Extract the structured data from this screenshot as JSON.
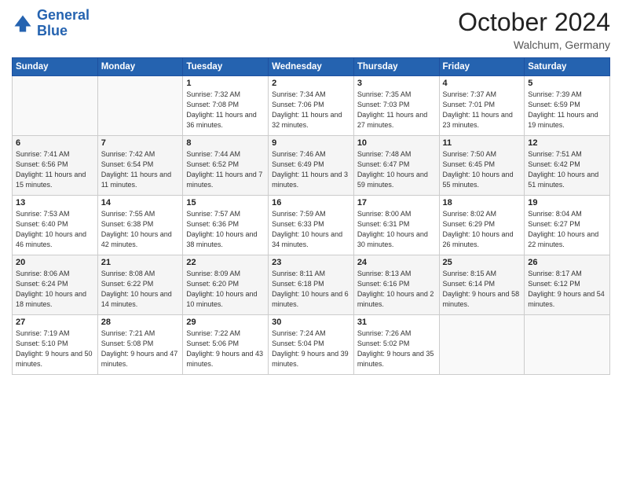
{
  "logo": {
    "line1": "General",
    "line2": "Blue"
  },
  "title": "October 2024",
  "location": "Walchum, Germany",
  "days_of_week": [
    "Sunday",
    "Monday",
    "Tuesday",
    "Wednesday",
    "Thursday",
    "Friday",
    "Saturday"
  ],
  "weeks": [
    [
      {
        "day": "",
        "content": ""
      },
      {
        "day": "",
        "content": ""
      },
      {
        "day": "1",
        "content": "Sunrise: 7:32 AM\nSunset: 7:08 PM\nDaylight: 11 hours and 36 minutes."
      },
      {
        "day": "2",
        "content": "Sunrise: 7:34 AM\nSunset: 7:06 PM\nDaylight: 11 hours and 32 minutes."
      },
      {
        "day": "3",
        "content": "Sunrise: 7:35 AM\nSunset: 7:03 PM\nDaylight: 11 hours and 27 minutes."
      },
      {
        "day": "4",
        "content": "Sunrise: 7:37 AM\nSunset: 7:01 PM\nDaylight: 11 hours and 23 minutes."
      },
      {
        "day": "5",
        "content": "Sunrise: 7:39 AM\nSunset: 6:59 PM\nDaylight: 11 hours and 19 minutes."
      }
    ],
    [
      {
        "day": "6",
        "content": "Sunrise: 7:41 AM\nSunset: 6:56 PM\nDaylight: 11 hours and 15 minutes."
      },
      {
        "day": "7",
        "content": "Sunrise: 7:42 AM\nSunset: 6:54 PM\nDaylight: 11 hours and 11 minutes."
      },
      {
        "day": "8",
        "content": "Sunrise: 7:44 AM\nSunset: 6:52 PM\nDaylight: 11 hours and 7 minutes."
      },
      {
        "day": "9",
        "content": "Sunrise: 7:46 AM\nSunset: 6:49 PM\nDaylight: 11 hours and 3 minutes."
      },
      {
        "day": "10",
        "content": "Sunrise: 7:48 AM\nSunset: 6:47 PM\nDaylight: 10 hours and 59 minutes."
      },
      {
        "day": "11",
        "content": "Sunrise: 7:50 AM\nSunset: 6:45 PM\nDaylight: 10 hours and 55 minutes."
      },
      {
        "day": "12",
        "content": "Sunrise: 7:51 AM\nSunset: 6:42 PM\nDaylight: 10 hours and 51 minutes."
      }
    ],
    [
      {
        "day": "13",
        "content": "Sunrise: 7:53 AM\nSunset: 6:40 PM\nDaylight: 10 hours and 46 minutes."
      },
      {
        "day": "14",
        "content": "Sunrise: 7:55 AM\nSunset: 6:38 PM\nDaylight: 10 hours and 42 minutes."
      },
      {
        "day": "15",
        "content": "Sunrise: 7:57 AM\nSunset: 6:36 PM\nDaylight: 10 hours and 38 minutes."
      },
      {
        "day": "16",
        "content": "Sunrise: 7:59 AM\nSunset: 6:33 PM\nDaylight: 10 hours and 34 minutes."
      },
      {
        "day": "17",
        "content": "Sunrise: 8:00 AM\nSunset: 6:31 PM\nDaylight: 10 hours and 30 minutes."
      },
      {
        "day": "18",
        "content": "Sunrise: 8:02 AM\nSunset: 6:29 PM\nDaylight: 10 hours and 26 minutes."
      },
      {
        "day": "19",
        "content": "Sunrise: 8:04 AM\nSunset: 6:27 PM\nDaylight: 10 hours and 22 minutes."
      }
    ],
    [
      {
        "day": "20",
        "content": "Sunrise: 8:06 AM\nSunset: 6:24 PM\nDaylight: 10 hours and 18 minutes."
      },
      {
        "day": "21",
        "content": "Sunrise: 8:08 AM\nSunset: 6:22 PM\nDaylight: 10 hours and 14 minutes."
      },
      {
        "day": "22",
        "content": "Sunrise: 8:09 AM\nSunset: 6:20 PM\nDaylight: 10 hours and 10 minutes."
      },
      {
        "day": "23",
        "content": "Sunrise: 8:11 AM\nSunset: 6:18 PM\nDaylight: 10 hours and 6 minutes."
      },
      {
        "day": "24",
        "content": "Sunrise: 8:13 AM\nSunset: 6:16 PM\nDaylight: 10 hours and 2 minutes."
      },
      {
        "day": "25",
        "content": "Sunrise: 8:15 AM\nSunset: 6:14 PM\nDaylight: 9 hours and 58 minutes."
      },
      {
        "day": "26",
        "content": "Sunrise: 8:17 AM\nSunset: 6:12 PM\nDaylight: 9 hours and 54 minutes."
      }
    ],
    [
      {
        "day": "27",
        "content": "Sunrise: 7:19 AM\nSunset: 5:10 PM\nDaylight: 9 hours and 50 minutes."
      },
      {
        "day": "28",
        "content": "Sunrise: 7:21 AM\nSunset: 5:08 PM\nDaylight: 9 hours and 47 minutes."
      },
      {
        "day": "29",
        "content": "Sunrise: 7:22 AM\nSunset: 5:06 PM\nDaylight: 9 hours and 43 minutes."
      },
      {
        "day": "30",
        "content": "Sunrise: 7:24 AM\nSunset: 5:04 PM\nDaylight: 9 hours and 39 minutes."
      },
      {
        "day": "31",
        "content": "Sunrise: 7:26 AM\nSunset: 5:02 PM\nDaylight: 9 hours and 35 minutes."
      },
      {
        "day": "",
        "content": ""
      },
      {
        "day": "",
        "content": ""
      }
    ]
  ]
}
